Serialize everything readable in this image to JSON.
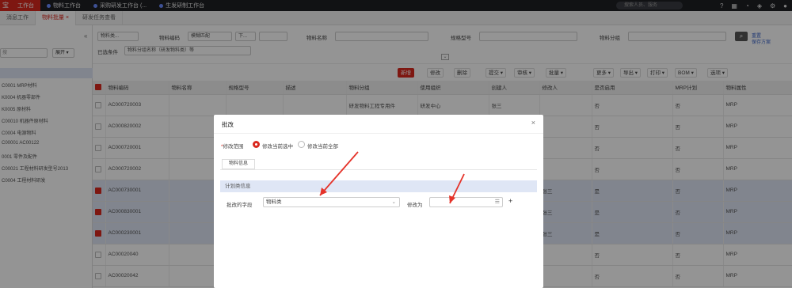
{
  "topbar": {
    "logo": "宝",
    "tabs": [
      {
        "label": "工作台",
        "active": true
      },
      {
        "label": "物料工作台",
        "active": false
      },
      {
        "label": "采购研发工作台 (...",
        "active": false
      },
      {
        "label": "生发研制工作台",
        "active": false
      }
    ],
    "search_placeholder": "搜索人员、服务",
    "icons": [
      "help-icon",
      "calendar-icon",
      "bell-icon",
      "app-icon",
      "settings-icon",
      "avatar"
    ]
  },
  "subtabs": [
    {
      "label": "消息工作",
      "active": false
    },
    {
      "label": "物料批量",
      "active": true
    },
    {
      "label": "研发任务查看",
      "active": false
    }
  ],
  "left": {
    "collapse_label": "«",
    "search_placeholder": "搜",
    "expand_label": "展开 ▾",
    "items": [
      "C0001 MRP材料",
      "K0004 机器零部件",
      "K0005 原材料",
      "C00010 机器件原材料",
      "C0004 电源物料",
      "C00001 AC00122",
      "0001 零件及配件",
      "C00021 工程材料研发型号2013",
      "C0004 工程材料研发"
    ]
  },
  "filters": {
    "type_select": "物料类...",
    "f1_label": "物料编码",
    "f1_op": "模糊匹配",
    "f1_op2": "下...",
    "f1_val": "",
    "f2_label": "物料名称",
    "f3_label": "规格型号",
    "f4_label": "物料分组",
    "row2_label": "已选条件",
    "row2_val": "物料分组名称（研发物料类）等",
    "reset_label": "重置",
    "save_label": "保存方案",
    "search_label": "⌕"
  },
  "toolbar": {
    "buttons": [
      "新增",
      "修改",
      "删除",
      "提交 ▾",
      "审核 ▾",
      "批量 ▾",
      "更多 ▾",
      "导出 ▾",
      "打印 ▾",
      "BOM ▾",
      "选项 ▾"
    ]
  },
  "table": {
    "headers": [
      "",
      "物料编码",
      "物料名称",
      "规格型号",
      "描述",
      "物料分组",
      "使用组织",
      "创建人",
      "修改人",
      "是否启用",
      "MRP计划",
      "物料属性"
    ],
    "rows": [
      {
        "sel": false,
        "code": "AC000720003",
        "group": "研发物料工程专用件",
        "org": "研发中心",
        "creator": "张三",
        "enabled": "否",
        "mrp": "否",
        "attr": "MRP"
      },
      {
        "sel": false,
        "code": "AC000820002",
        "group": "",
        "org": "",
        "creator": "张三",
        "enabled": "否",
        "mrp": "否",
        "attr": "MRP"
      },
      {
        "sel": false,
        "code": "AC000720001",
        "group": "",
        "org": "",
        "creator": "张三",
        "enabled": "否",
        "mrp": "否",
        "attr": "MRP"
      },
      {
        "sel": false,
        "code": "AC000720002",
        "group": "",
        "org": "",
        "creator": "张三",
        "enabled": "否",
        "mrp": "否",
        "attr": "MRP"
      },
      {
        "sel": true,
        "code": "AC000730001",
        "group": "",
        "org": "",
        "creator": "张三",
        "modifier": "张三",
        "enabled": "是",
        "mrp": "否",
        "attr": "MRP"
      },
      {
        "sel": true,
        "code": "AC000830001",
        "group": "",
        "org": "",
        "creator": "张三",
        "modifier": "张三",
        "enabled": "是",
        "mrp": "否",
        "attr": "MRP"
      },
      {
        "sel": true,
        "code": "AC000230001",
        "group": "",
        "org": "",
        "creator": "张三",
        "modifier": "张三",
        "enabled": "是",
        "mrp": "否",
        "attr": "MRP"
      },
      {
        "sel": false,
        "code": "AC00020040",
        "group": "",
        "org": "",
        "creator": "张三",
        "enabled": "否",
        "mrp": "否",
        "attr": "MRP"
      },
      {
        "sel": false,
        "code": "AC00020042",
        "group": "",
        "org": "",
        "creator": "张三",
        "enabled": "否",
        "mrp": "否",
        "attr": "MRP"
      }
    ]
  },
  "modal": {
    "title": "批改",
    "close": "×",
    "scope_label": "修改范围",
    "scope_required": "*",
    "option1": "修改当前选中",
    "option2": "修改当前全部",
    "tab": "物料信息",
    "group": "计划类信息",
    "field_label": "批改的字段",
    "field_value": "物料类",
    "value_label": "修改为",
    "value": "",
    "plus": "+"
  }
}
